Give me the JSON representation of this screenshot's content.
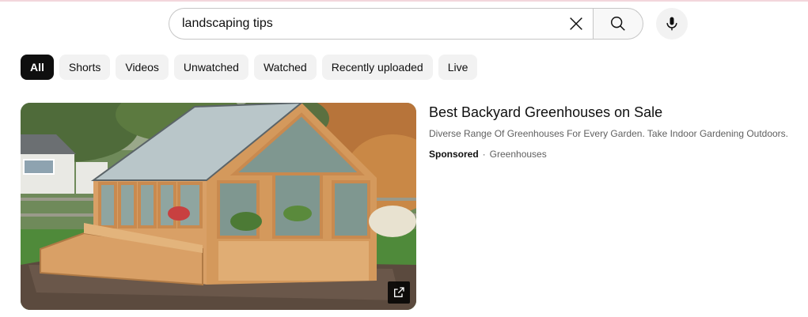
{
  "search": {
    "query": "landscaping tips",
    "clear_icon": "close-icon",
    "search_icon": "search-icon",
    "mic_icon": "microphone-icon"
  },
  "chips": [
    {
      "label": "All",
      "active": true
    },
    {
      "label": "Shorts",
      "active": false
    },
    {
      "label": "Videos",
      "active": false
    },
    {
      "label": "Unwatched",
      "active": false
    },
    {
      "label": "Watched",
      "active": false
    },
    {
      "label": "Recently uploaded",
      "active": false
    },
    {
      "label": "Live",
      "active": false
    }
  ],
  "ad": {
    "title": "Best Backyard Greenhouses on Sale",
    "description": "Diverse Range Of Greenhouses For Every Garden. Take Indoor Gardening Outdoors.",
    "sponsored_label": "Sponsored",
    "separator": "·",
    "advertiser": "Greenhouses",
    "thumbnail_icon": "external-link-icon"
  },
  "colors": {
    "chip_active_bg": "#0f0f0f",
    "chip_bg": "#f2f2f2",
    "text_secondary": "#606060"
  }
}
